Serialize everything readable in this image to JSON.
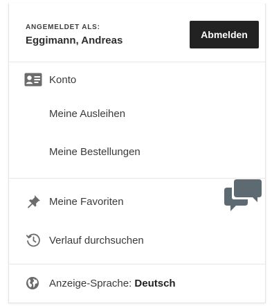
{
  "header": {
    "signed_in_label": "ANGEMELDET ALS:",
    "user_name": "Eggimann, Andreas",
    "logout_label": "Abmelden"
  },
  "account_menu": {
    "konto": {
      "label": "Konto",
      "icon": "id-card-icon"
    },
    "ausleihen": {
      "label": "Meine Ausleihen"
    },
    "bestellungen": {
      "label": "Meine Bestellungen"
    }
  },
  "favorites_menu": {
    "favoriten": {
      "label": "Meine Favoriten",
      "icon": "pin-icon"
    },
    "verlauf": {
      "label": "Verlauf durchsuchen",
      "icon": "history-icon"
    }
  },
  "language": {
    "label": "Anzeige-Sprache:",
    "value": "Deutsch",
    "icon": "globe-icon"
  },
  "chat": {
    "icon": "chat-bubbles-icon"
  },
  "colors": {
    "button_bg": "#222222",
    "button_text": "#ffffff",
    "text": "#3a3a3a",
    "icon": "#6b6b6b",
    "chat_icon": "#5e6a72",
    "divider": "#e7e7e7"
  }
}
